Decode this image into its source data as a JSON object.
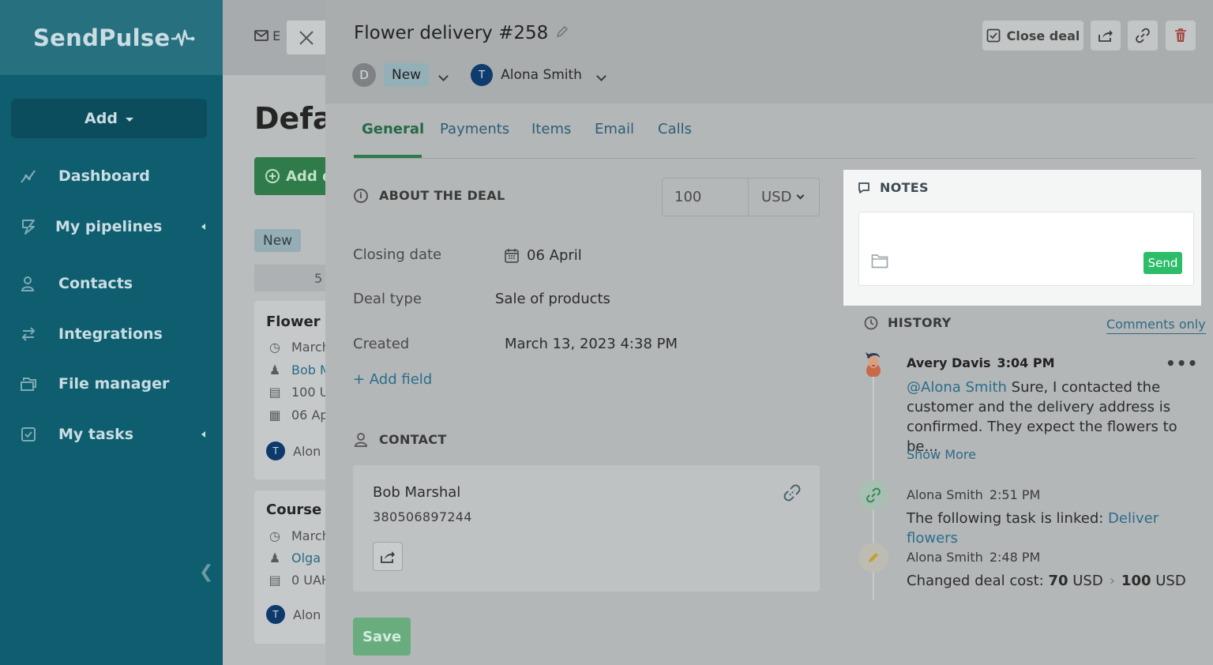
{
  "sidebar": {
    "logo": "SendPulse",
    "add_label": "Add",
    "items": [
      {
        "label": "Dashboard",
        "icon": "chart-line-icon"
      },
      {
        "label": "My pipelines",
        "icon": "funnel-icon"
      },
      {
        "label": "Contacts",
        "icon": "user-group-icon"
      },
      {
        "label": "Integrations",
        "icon": "arrows-swap-icon"
      },
      {
        "label": "File manager",
        "icon": "folder-stack-icon"
      },
      {
        "label": "My tasks",
        "icon": "checkbox-icon"
      }
    ]
  },
  "board": {
    "top_item": "E",
    "page_title": "Defa",
    "add_deal": "Add d",
    "stage_tag": "New",
    "stage_count": "5",
    "cards": [
      {
        "title": "Flower d",
        "date": "March",
        "contact": "Bob M",
        "amount": "100 U",
        "due": "06 Ap",
        "owner": "Alon",
        "owner_initial": "T"
      },
      {
        "title": "Course q",
        "date": "March",
        "contact": "Olga",
        "amount": "0 UAH",
        "owner": "Alon",
        "owner_initial": "T"
      }
    ]
  },
  "deal": {
    "title": "Flower delivery #258",
    "stage_initial": "D",
    "stage": "New",
    "owner_initial": "T",
    "owner": "Alona Smith",
    "close_deal": "Close deal",
    "tabs": [
      "General",
      "Payments",
      "Items",
      "Email",
      "Calls"
    ],
    "about_heading": "ABOUT THE DEAL",
    "cost_value": "100",
    "currency": "USD",
    "fields": [
      {
        "label": "Closing date",
        "value": "06 April"
      },
      {
        "label": "Deal type",
        "value": "Sale of products"
      },
      {
        "label": "Created",
        "value": "March 13, 2023 4:38 PM"
      }
    ],
    "add_field": "+ Add field",
    "contact_heading": "CONTACT",
    "contact": {
      "name": "Bob Marshal",
      "phone": "380506897244"
    },
    "save": "Save"
  },
  "notes": {
    "heading": "NOTES",
    "send": "Send"
  },
  "history": {
    "heading": "HISTORY",
    "filter": "Comments only",
    "show_more": "Show More",
    "entries": [
      {
        "author": "Avery Davis",
        "time": "3:04 PM",
        "mention": "@Alona Smith",
        "text_line1": " Sure, I contacted the",
        "text_line2": "customer and the delivery address is",
        "text_line3": "confirmed. They expect the flowers to be..."
      },
      {
        "author": "Alona Smith",
        "time": "2:51 PM",
        "text": "The following task is linked: ",
        "link": "Deliver flowers"
      },
      {
        "author": "Alona Smith",
        "time": "2:48 PM",
        "text": "Changed deal cost: ",
        "old_value": "70",
        "old_currency": "USD",
        "new_value": "100",
        "new_currency": "USD"
      }
    ]
  },
  "colors": {
    "sidebar": "#0e5e70",
    "accent_green": "#2dbd6a",
    "link_blue": "#2c6d8b"
  }
}
